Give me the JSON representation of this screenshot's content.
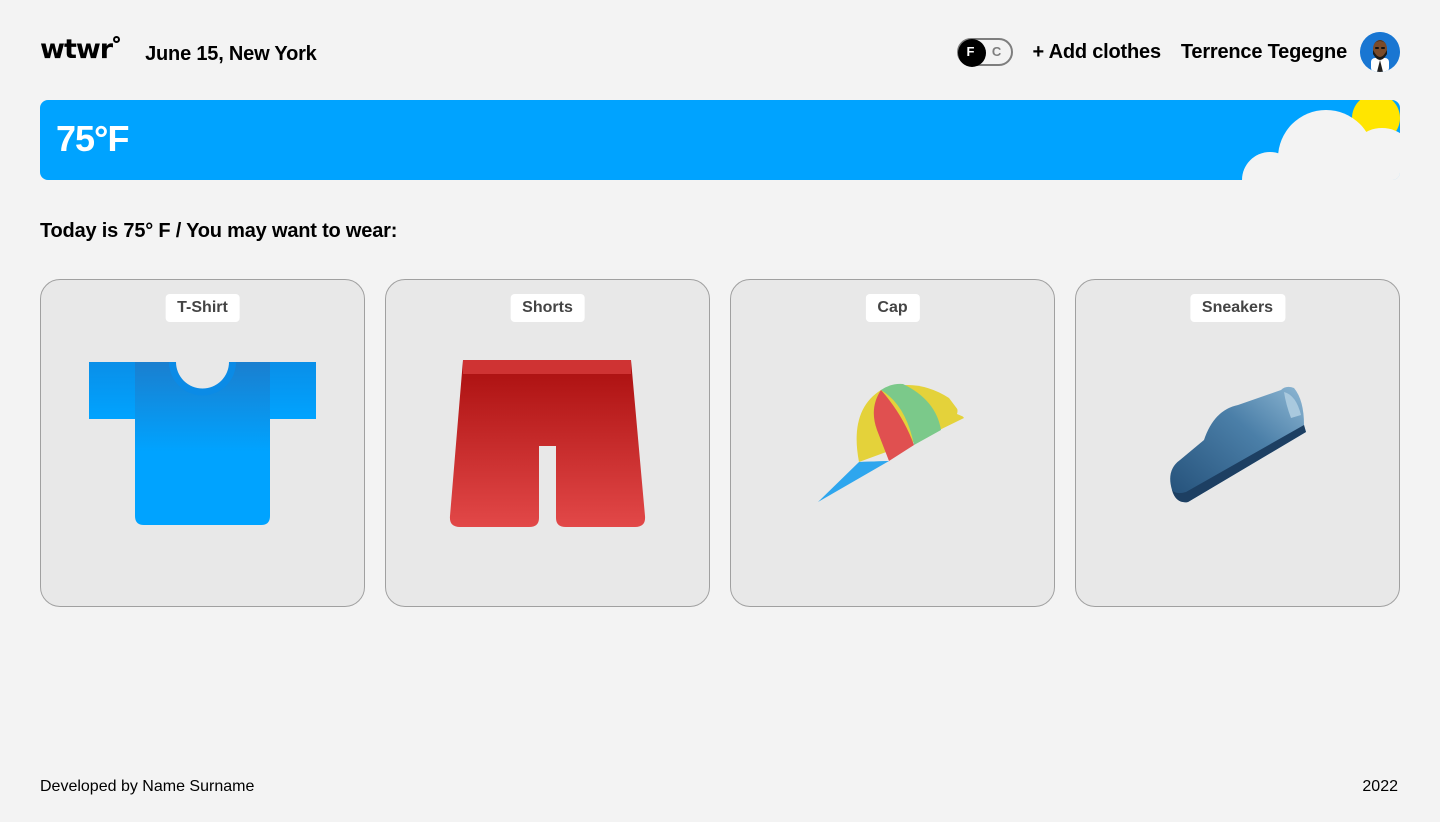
{
  "header": {
    "logo": "wtwr",
    "date_location": "June 15, New York",
    "toggle": {
      "left": "F",
      "right": "C",
      "selected": "F"
    },
    "add_clothes_label": "+ Add clothes",
    "username": "Terrence Tegegne"
  },
  "weather": {
    "temperature": "75°F",
    "condition_icons": [
      "sun-icon",
      "cloud-icon"
    ],
    "banner_color": "#00A3FF"
  },
  "recommendation": {
    "heading": "Today is 75° F / You may want to wear:"
  },
  "items": [
    {
      "name": "T-Shirt",
      "icon": "tshirt-icon"
    },
    {
      "name": "Shorts",
      "icon": "shorts-icon"
    },
    {
      "name": "Cap",
      "icon": "cap-icon"
    },
    {
      "name": "Sneakers",
      "icon": "sneaker-icon"
    }
  ],
  "footer": {
    "credit": "Developed by Name Surname",
    "year": "2022"
  }
}
